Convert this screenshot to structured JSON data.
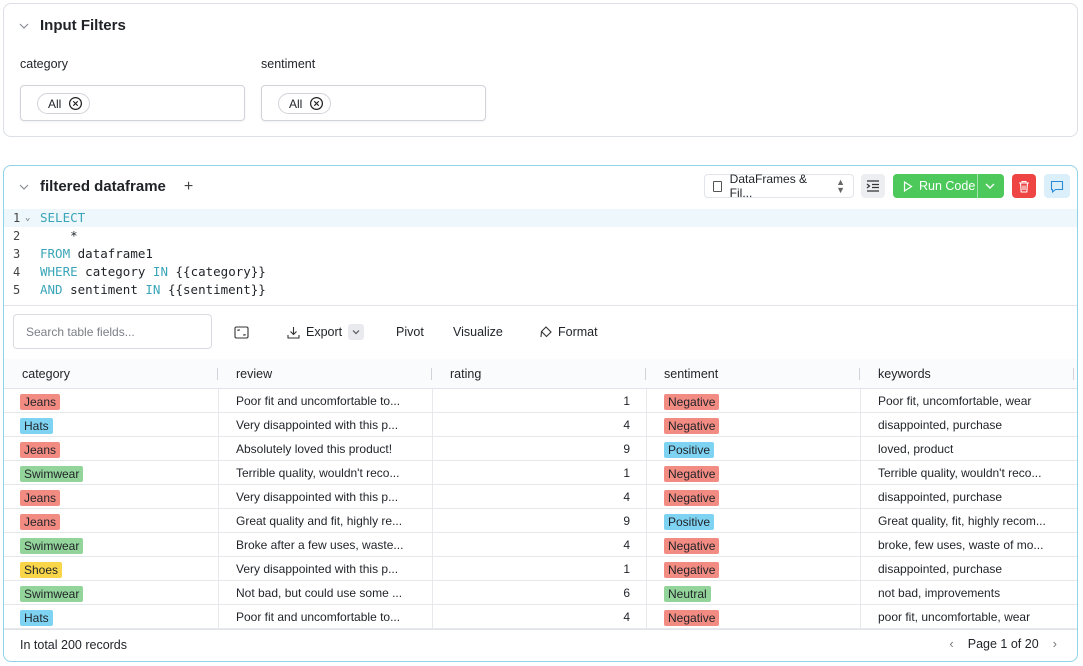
{
  "input_filters": {
    "title": "Input Filters",
    "filters": [
      {
        "label": "category",
        "selected": "All"
      },
      {
        "label": "sentiment",
        "selected": "All"
      }
    ]
  },
  "sql_block": {
    "title": "filtered dataframe",
    "source_select": "DataFrames & Fil...",
    "run_label": "Run Code",
    "code_lines": [
      {
        "num": "1",
        "text": "SELECT"
      },
      {
        "num": "2",
        "text": "    *"
      },
      {
        "num": "3",
        "text": "FROM dataframe1"
      },
      {
        "num": "4",
        "text": "WHERE category IN {{category}}"
      },
      {
        "num": "5",
        "text": "AND sentiment IN {{sentiment}}"
      }
    ]
  },
  "toolbar": {
    "search_placeholder": "Search table fields...",
    "export": "Export",
    "pivot": "Pivot",
    "visualize": "Visualize",
    "format": "Format"
  },
  "table": {
    "columns": [
      "category",
      "review",
      "rating",
      "sentiment",
      "keywords"
    ],
    "rows": [
      {
        "category": "Jeans",
        "review": "Poor fit and uncomfortable to...",
        "rating": "1",
        "sentiment": "Negative",
        "keywords": "Poor fit, uncomfortable, wear"
      },
      {
        "category": "Hats",
        "review": "Very disappointed with this p...",
        "rating": "4",
        "sentiment": "Negative",
        "keywords": "disappointed, purchase"
      },
      {
        "category": "Jeans",
        "review": "Absolutely loved this product!",
        "rating": "9",
        "sentiment": "Positive",
        "keywords": "loved, product"
      },
      {
        "category": "Swimwear",
        "review": "Terrible quality, wouldn't reco...",
        "rating": "1",
        "sentiment": "Negative",
        "keywords": "Terrible quality, wouldn't reco..."
      },
      {
        "category": "Jeans",
        "review": "Very disappointed with this p...",
        "rating": "4",
        "sentiment": "Negative",
        "keywords": "disappointed, purchase"
      },
      {
        "category": "Jeans",
        "review": "Great quality and fit, highly re...",
        "rating": "9",
        "sentiment": "Positive",
        "keywords": "Great quality, fit, highly recom..."
      },
      {
        "category": "Swimwear",
        "review": "Broke after a few uses, waste...",
        "rating": "4",
        "sentiment": "Negative",
        "keywords": "broke, few uses, waste of mo..."
      },
      {
        "category": "Shoes",
        "review": "Very disappointed with this p...",
        "rating": "1",
        "sentiment": "Negative",
        "keywords": "disappointed, purchase"
      },
      {
        "category": "Swimwear",
        "review": "Not bad, but could use some ...",
        "rating": "6",
        "sentiment": "Neutral",
        "keywords": "not bad, improvements"
      },
      {
        "category": "Hats",
        "review": "Poor fit and uncomfortable to...",
        "rating": "4",
        "sentiment": "Negative",
        "keywords": "poor fit, uncomfortable, wear"
      }
    ],
    "tag_colors": {
      "Jeans": "#f28b82",
      "Hats": "#7fd3f2",
      "Swimwear": "#93d49a",
      "Shoes": "#f9d54a",
      "Negative": "#f28b82",
      "Positive": "#7fd3f2",
      "Neutral": "#93d49a"
    }
  },
  "footer": {
    "total": "In total 200 records",
    "page": "Page 1 of 20"
  }
}
